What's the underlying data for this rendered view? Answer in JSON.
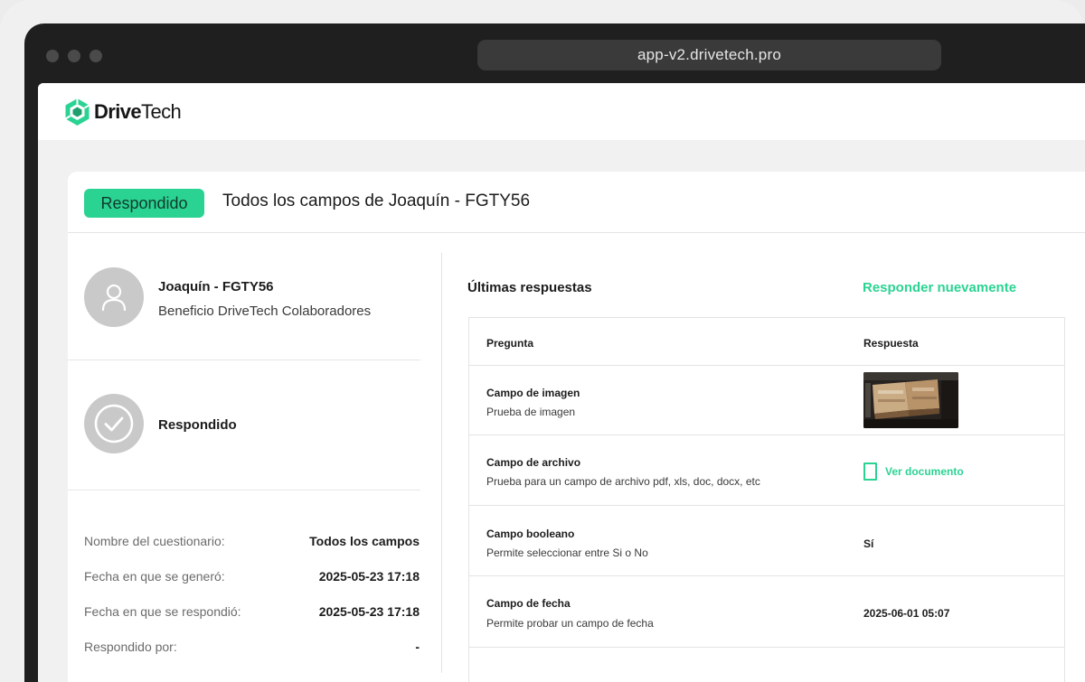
{
  "browser": {
    "url": "app-v2.drivetech.pro"
  },
  "brand": {
    "name_bold": "Drive",
    "name_light": "Tech",
    "accent": "#2bd393"
  },
  "header": {
    "status": "Respondido",
    "title": "Todos los campos de Joaquín - FGTY56"
  },
  "user": {
    "name": "Joaquín - FGTY56",
    "subtitle": "Beneficio DriveTech Colaboradores",
    "avatar_icon": "user-icon"
  },
  "state": {
    "label": "Respondido",
    "icon": "check-icon"
  },
  "info": [
    {
      "label": "Nombre del cuestionario:",
      "value": "Todos los campos"
    },
    {
      "label": "Fecha en que se generó:",
      "value": "2025-05-23 17:18"
    },
    {
      "label": "Fecha en que se respondió:",
      "value": "2025-05-23 17:18"
    },
    {
      "label": "Respondido por:",
      "value": "-"
    }
  ],
  "responses": {
    "title": "Últimas respuestas",
    "action": "Responder nuevamente",
    "columns": {
      "question": "Pregunta",
      "answer": "Respuesta"
    },
    "rows": [
      {
        "title": "Campo de imagen",
        "desc": "Prueba de imagen",
        "answer": "",
        "answer_type": "image"
      },
      {
        "title": "Campo de archivo",
        "desc": "Prueba para un campo de archivo pdf, xls, doc, docx, etc",
        "answer": "Ver documento",
        "answer_type": "document"
      },
      {
        "title": "Campo booleano",
        "desc": "Permite seleccionar entre Si o No",
        "answer": "Sí",
        "answer_type": "text"
      },
      {
        "title": "Campo de fecha",
        "desc": "Permite probar un campo de fecha",
        "answer": "2025-06-01 05:07",
        "answer_type": "text"
      }
    ]
  }
}
